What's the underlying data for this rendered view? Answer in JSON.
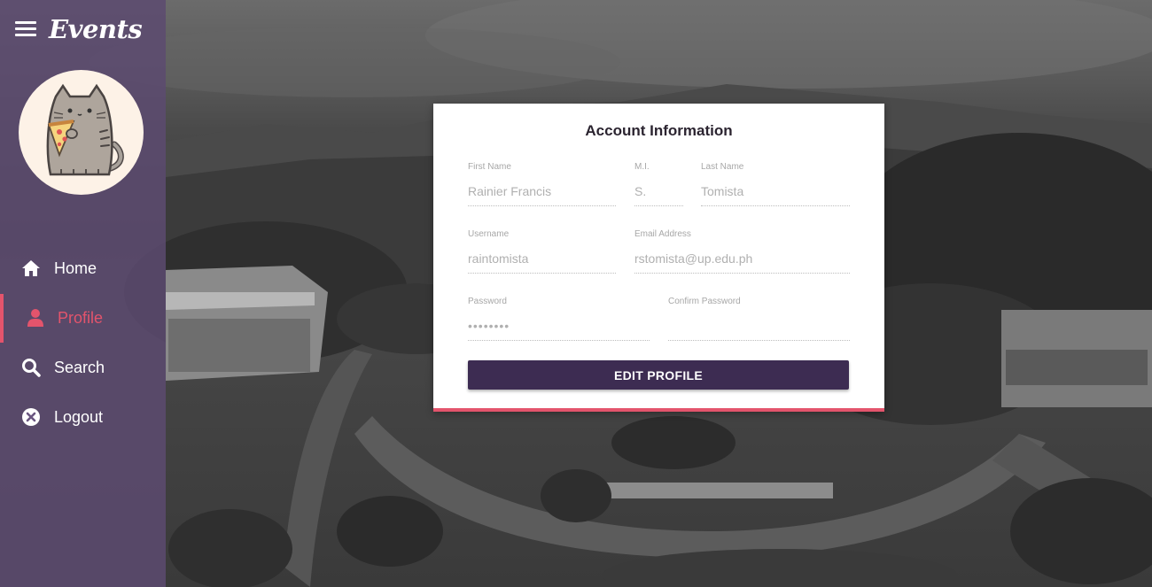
{
  "app": {
    "title": "Events"
  },
  "colors": {
    "accent": "#e3546c",
    "sidebar": "#5c4a70",
    "button": "#3d2c52"
  },
  "sidebar": {
    "menu_icon": "hamburger-menu-icon",
    "avatar_icon": "cat-eating-pizza-avatar",
    "items": [
      {
        "label": "Home",
        "icon": "home-icon",
        "active": false
      },
      {
        "label": "Profile",
        "icon": "user-icon",
        "active": true
      },
      {
        "label": "Search",
        "icon": "search-icon",
        "active": false
      },
      {
        "label": "Logout",
        "icon": "close-circle-icon",
        "active": false
      }
    ]
  },
  "account": {
    "title": "Account Information",
    "first_name": {
      "label": "First Name",
      "value": "Rainier Francis"
    },
    "middle_initial": {
      "label": "M.I.",
      "value": "S."
    },
    "last_name": {
      "label": "Last Name",
      "value": "Tomista"
    },
    "username": {
      "label": "Username",
      "value": "raintomista"
    },
    "email": {
      "label": "Email Address",
      "value": "rstomista@up.edu.ph"
    },
    "password": {
      "label": "Password",
      "value": "••••••••"
    },
    "confirm_password": {
      "label": "Confirm Password",
      "value": ""
    },
    "edit_button": "EDIT PROFILE"
  }
}
